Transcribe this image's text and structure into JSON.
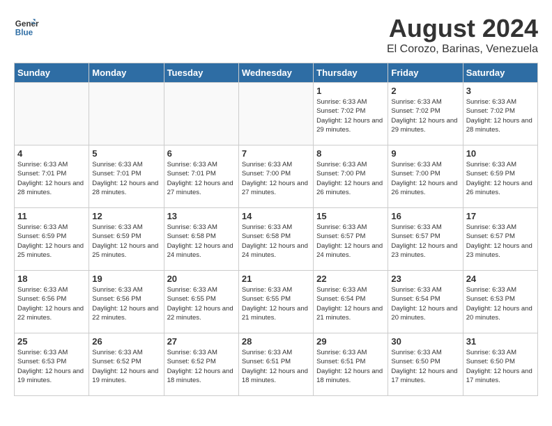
{
  "header": {
    "logo_line1": "General",
    "logo_line2": "Blue",
    "month_year": "August 2024",
    "location": "El Corozo, Barinas, Venezuela"
  },
  "weekdays": [
    "Sunday",
    "Monday",
    "Tuesday",
    "Wednesday",
    "Thursday",
    "Friday",
    "Saturday"
  ],
  "weeks": [
    [
      {
        "day": "",
        "empty": true
      },
      {
        "day": "",
        "empty": true
      },
      {
        "day": "",
        "empty": true
      },
      {
        "day": "",
        "empty": true
      },
      {
        "day": "1",
        "sunrise": "6:33 AM",
        "sunset": "7:02 PM",
        "daylight": "12 hours and 29 minutes."
      },
      {
        "day": "2",
        "sunrise": "6:33 AM",
        "sunset": "7:02 PM",
        "daylight": "12 hours and 29 minutes."
      },
      {
        "day": "3",
        "sunrise": "6:33 AM",
        "sunset": "7:02 PM",
        "daylight": "12 hours and 28 minutes."
      }
    ],
    [
      {
        "day": "4",
        "sunrise": "6:33 AM",
        "sunset": "7:01 PM",
        "daylight": "12 hours and 28 minutes."
      },
      {
        "day": "5",
        "sunrise": "6:33 AM",
        "sunset": "7:01 PM",
        "daylight": "12 hours and 28 minutes."
      },
      {
        "day": "6",
        "sunrise": "6:33 AM",
        "sunset": "7:01 PM",
        "daylight": "12 hours and 27 minutes."
      },
      {
        "day": "7",
        "sunrise": "6:33 AM",
        "sunset": "7:00 PM",
        "daylight": "12 hours and 27 minutes."
      },
      {
        "day": "8",
        "sunrise": "6:33 AM",
        "sunset": "7:00 PM",
        "daylight": "12 hours and 26 minutes."
      },
      {
        "day": "9",
        "sunrise": "6:33 AM",
        "sunset": "7:00 PM",
        "daylight": "12 hours and 26 minutes."
      },
      {
        "day": "10",
        "sunrise": "6:33 AM",
        "sunset": "6:59 PM",
        "daylight": "12 hours and 26 minutes."
      }
    ],
    [
      {
        "day": "11",
        "sunrise": "6:33 AM",
        "sunset": "6:59 PM",
        "daylight": "12 hours and 25 minutes."
      },
      {
        "day": "12",
        "sunrise": "6:33 AM",
        "sunset": "6:59 PM",
        "daylight": "12 hours and 25 minutes."
      },
      {
        "day": "13",
        "sunrise": "6:33 AM",
        "sunset": "6:58 PM",
        "daylight": "12 hours and 24 minutes."
      },
      {
        "day": "14",
        "sunrise": "6:33 AM",
        "sunset": "6:58 PM",
        "daylight": "12 hours and 24 minutes."
      },
      {
        "day": "15",
        "sunrise": "6:33 AM",
        "sunset": "6:57 PM",
        "daylight": "12 hours and 24 minutes."
      },
      {
        "day": "16",
        "sunrise": "6:33 AM",
        "sunset": "6:57 PM",
        "daylight": "12 hours and 23 minutes."
      },
      {
        "day": "17",
        "sunrise": "6:33 AM",
        "sunset": "6:57 PM",
        "daylight": "12 hours and 23 minutes."
      }
    ],
    [
      {
        "day": "18",
        "sunrise": "6:33 AM",
        "sunset": "6:56 PM",
        "daylight": "12 hours and 22 minutes."
      },
      {
        "day": "19",
        "sunrise": "6:33 AM",
        "sunset": "6:56 PM",
        "daylight": "12 hours and 22 minutes."
      },
      {
        "day": "20",
        "sunrise": "6:33 AM",
        "sunset": "6:55 PM",
        "daylight": "12 hours and 22 minutes."
      },
      {
        "day": "21",
        "sunrise": "6:33 AM",
        "sunset": "6:55 PM",
        "daylight": "12 hours and 21 minutes."
      },
      {
        "day": "22",
        "sunrise": "6:33 AM",
        "sunset": "6:54 PM",
        "daylight": "12 hours and 21 minutes."
      },
      {
        "day": "23",
        "sunrise": "6:33 AM",
        "sunset": "6:54 PM",
        "daylight": "12 hours and 20 minutes."
      },
      {
        "day": "24",
        "sunrise": "6:33 AM",
        "sunset": "6:53 PM",
        "daylight": "12 hours and 20 minutes."
      }
    ],
    [
      {
        "day": "25",
        "sunrise": "6:33 AM",
        "sunset": "6:53 PM",
        "daylight": "12 hours and 19 minutes."
      },
      {
        "day": "26",
        "sunrise": "6:33 AM",
        "sunset": "6:52 PM",
        "daylight": "12 hours and 19 minutes."
      },
      {
        "day": "27",
        "sunrise": "6:33 AM",
        "sunset": "6:52 PM",
        "daylight": "12 hours and 18 minutes."
      },
      {
        "day": "28",
        "sunrise": "6:33 AM",
        "sunset": "6:51 PM",
        "daylight": "12 hours and 18 minutes."
      },
      {
        "day": "29",
        "sunrise": "6:33 AM",
        "sunset": "6:51 PM",
        "daylight": "12 hours and 18 minutes."
      },
      {
        "day": "30",
        "sunrise": "6:33 AM",
        "sunset": "6:50 PM",
        "daylight": "12 hours and 17 minutes."
      },
      {
        "day": "31",
        "sunrise": "6:33 AM",
        "sunset": "6:50 PM",
        "daylight": "12 hours and 17 minutes."
      }
    ]
  ],
  "labels": {
    "sunrise_prefix": "Sunrise: ",
    "sunset_prefix": "Sunset: ",
    "daylight_prefix": "Daylight: "
  }
}
